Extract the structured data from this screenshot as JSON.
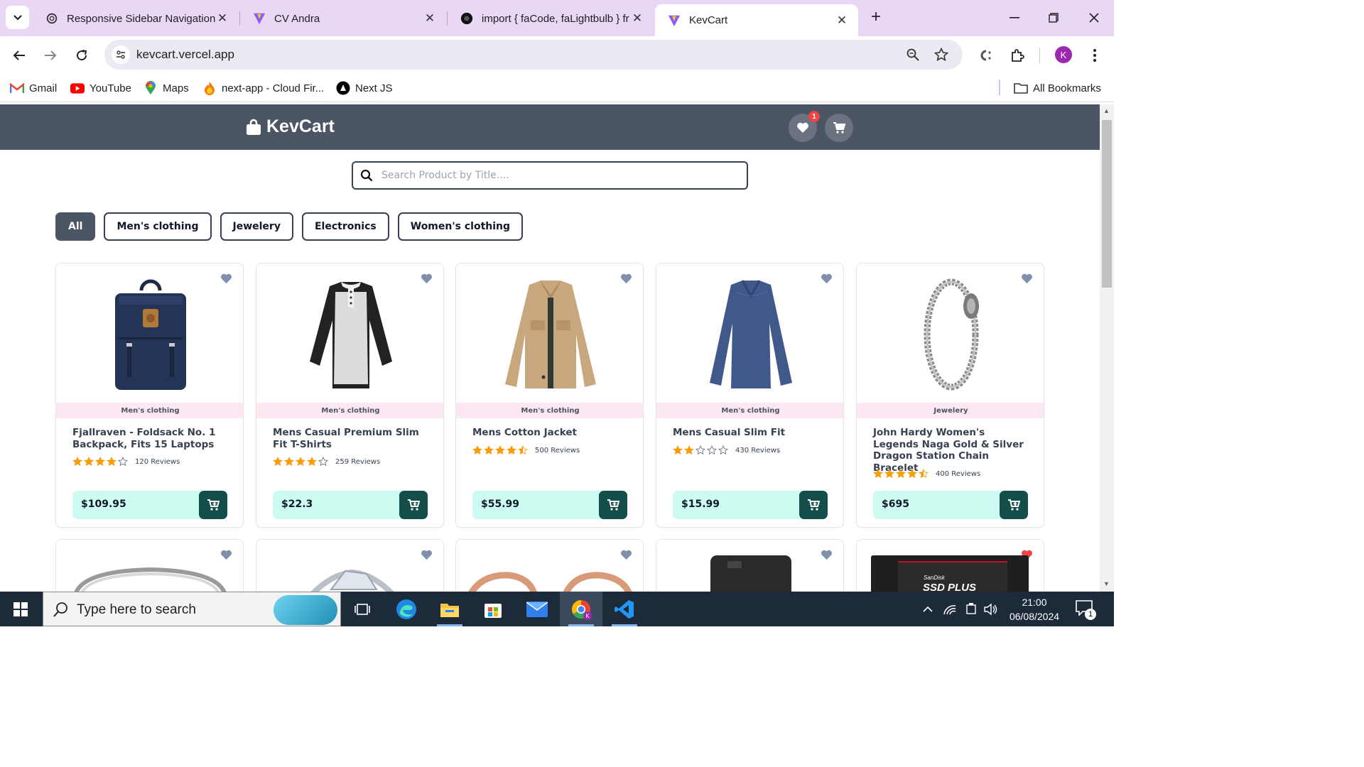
{
  "browser": {
    "tabs": [
      {
        "title": "Responsive Sidebar Navigation",
        "icon": "openai-icon"
      },
      {
        "title": "CV Andra",
        "icon": "vite-icon"
      },
      {
        "title": "import { faCode, faLightbulb } fr",
        "icon": "circle-icon"
      },
      {
        "title": "KevCart",
        "icon": "vite-icon",
        "active": true
      }
    ],
    "url": "kevcart.vercel.app",
    "profile_initial": "K",
    "bookmarks": [
      {
        "label": "Gmail",
        "icon": "gmail-icon"
      },
      {
        "label": "YouTube",
        "icon": "youtube-icon"
      },
      {
        "label": "Maps",
        "icon": "maps-icon"
      },
      {
        "label": "next-app - Cloud Fir...",
        "icon": "firebase-icon"
      },
      {
        "label": "Next JS",
        "icon": "nextjs-icon"
      }
    ],
    "all_bookmarks": "All Bookmarks"
  },
  "site": {
    "brand": "KevCart",
    "wishlist_count": "1",
    "search_placeholder": "Search Product by Title....",
    "filters": [
      "All",
      "Men's clothing",
      "Jewelery",
      "Electronics",
      "Women's clothing"
    ],
    "active_filter": "All",
    "products": [
      {
        "category": "Men's clothing",
        "title": "Fjallraven - Foldsack No. 1 Backpack, Fits 15 Laptops",
        "rating": 4,
        "reviews": "120 Reviews",
        "price": "$109.95",
        "image": "backpack"
      },
      {
        "category": "Men's clothing",
        "title": "Mens Casual Premium Slim Fit T-Shirts",
        "rating": 4,
        "reviews": "259 Reviews",
        "price": "$22.3",
        "image": "tshirt"
      },
      {
        "category": "Men's clothing",
        "title": "Mens Cotton Jacket",
        "rating": 4.5,
        "reviews": "500 Reviews",
        "price": "$55.99",
        "image": "jacket"
      },
      {
        "category": "Men's clothing",
        "title": "Mens Casual Slim Fit",
        "rating": 2,
        "reviews": "430 Reviews",
        "price": "$15.99",
        "image": "sweater"
      },
      {
        "category": "Jewelery",
        "title": "John Hardy Women's Legends Naga Gold & Silver Dragon Station Chain Bracelet",
        "rating": 4.5,
        "reviews": "400 Reviews",
        "price": "$695",
        "image": "bracelet"
      }
    ],
    "second_row_favorited": [
      false,
      false,
      false,
      false,
      true
    ],
    "ssd_label_small": "SanDisk",
    "ssd_label": "SSD PLUS",
    "colors": {
      "header": "#4b5563",
      "category_bg": "#fce7f3",
      "price_bg": "#ccfbf1",
      "cart_btn": "#134e4a",
      "star": "#f59e0b",
      "favorite": "#ef4444"
    }
  },
  "taskbar": {
    "search_placeholder": "Type here to search",
    "time": "21:00",
    "date": "06/08/2024",
    "notifications": "1"
  }
}
